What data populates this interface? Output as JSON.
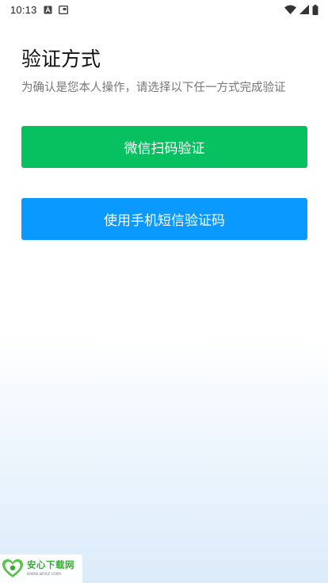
{
  "status_bar": {
    "time": "10:13",
    "left_icons": [
      "a-box-icon",
      "photo-icon"
    ],
    "right_icons": [
      "wifi-icon",
      "signal-icon",
      "battery-icon"
    ]
  },
  "page": {
    "title": "验证方式",
    "subtitle": "为确认是您本人操作，请选择以下任一方式完成验证"
  },
  "buttons": {
    "wechat_scan": {
      "label": "微信扫码验证",
      "color": "#07c160"
    },
    "sms_code": {
      "label": "使用手机短信验证码",
      "color": "#0a99ff"
    }
  },
  "watermark": {
    "brand": "安心下载网",
    "url": "www.anxz.com"
  }
}
